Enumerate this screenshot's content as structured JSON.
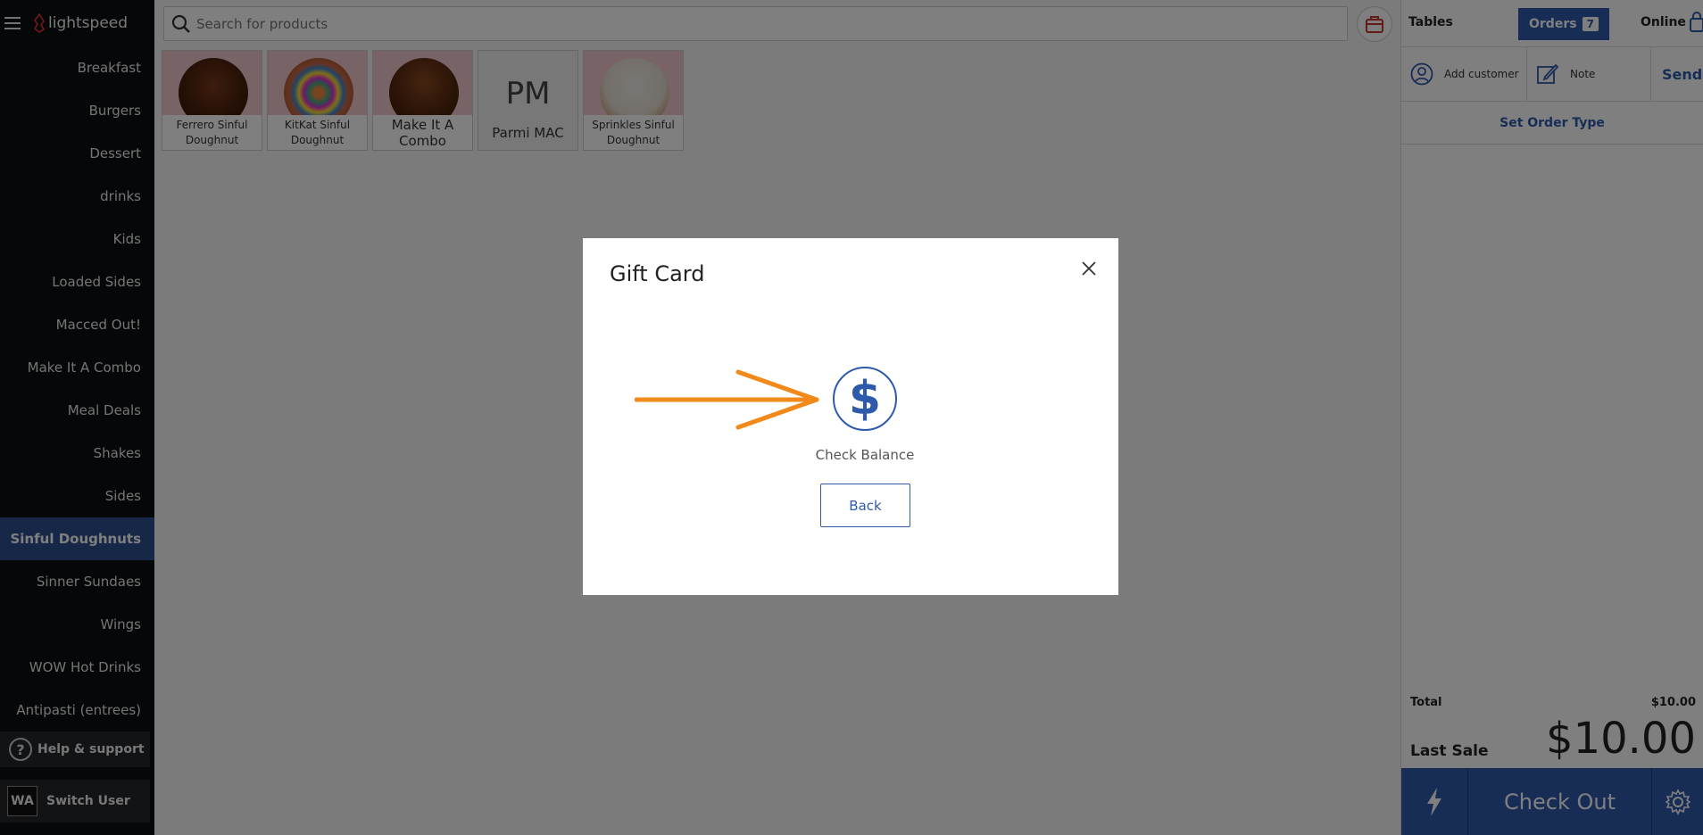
{
  "app": {
    "brand": "lightspeed"
  },
  "search": {
    "placeholder": "Search for products"
  },
  "categories": [
    "Breakfast",
    "Burgers",
    "Dessert",
    "drinks",
    "Kids",
    "Loaded Sides",
    "Macced Out!",
    "Make It A Combo",
    "Meal Deals",
    "Shakes",
    "Sides",
    "Sinful Doughnuts",
    "Sinner Sundaes",
    "Wings",
    "WOW Hot Drinks",
    "Antipasti (entrees)"
  ],
  "active_category": "Sinful Doughnuts",
  "sidebar_footer": {
    "help_label": "Help & support",
    "user_initials": "WA",
    "switch_label": "Switch User"
  },
  "products": [
    {
      "label": "Ferrero Sinful Doughnut"
    },
    {
      "label": "KitKat Sinful Doughnut"
    },
    {
      "label": "Make It A Combo"
    },
    {
      "label": "Parmi MAC",
      "initials": "PM"
    },
    {
      "label": "Sprinkles Sinful Doughnut"
    }
  ],
  "right_panel": {
    "tables_label": "Tables",
    "orders_label": "Orders",
    "orders_count": "7",
    "online_label": "Online",
    "add_customer": "Add customer",
    "note": "Note",
    "send": "Send",
    "set_order_type": "Set Order Type",
    "total_label": "Total",
    "total_value": "$10.00",
    "last_sale_label": "Last Sale",
    "last_sale_value": "$10.00",
    "checkout_label": "Check Out"
  },
  "modal": {
    "title": "Gift Card",
    "check_balance_label": "Check Balance",
    "back_label": "Back",
    "dollar_symbol": "$"
  },
  "colors": {
    "accent": "#2e5aac",
    "arrow": "#f28a1b",
    "sidebar_bg": "#0d0f12",
    "active_category_bg": "#2d4f8f"
  }
}
